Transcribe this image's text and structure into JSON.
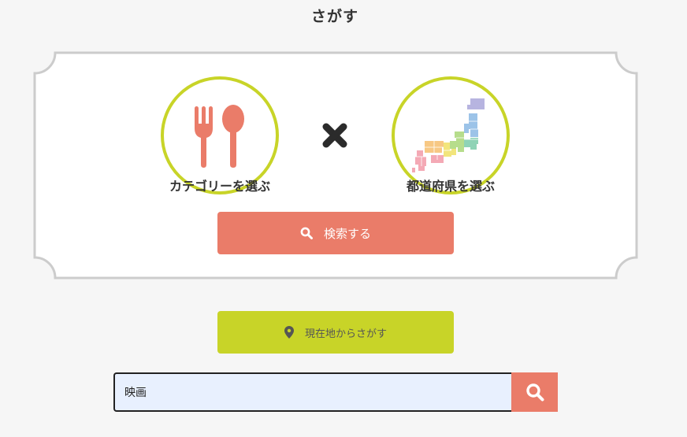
{
  "page": {
    "title": "さがす"
  },
  "picker": {
    "category_label": "カテゴリーを選ぶ",
    "category_icon": "fork-spoon-icon",
    "prefecture_label": "都道府県を選ぶ",
    "prefecture_icon": "japan-map-icon",
    "separator_icon": "times-icon"
  },
  "search_button": {
    "label": "検索する",
    "icon": "search-icon"
  },
  "location_button": {
    "label": "現在地からさがす",
    "icon": "location-pin-icon"
  },
  "keyword_search": {
    "value": "映画",
    "submit_icon": "search-icon"
  },
  "colors": {
    "background": "#f6f6f6",
    "accent_salmon": "#ea7c69",
    "accent_lime": "#c8d428",
    "frame_border": "#cccccc",
    "input_bg": "#e8f0fe"
  }
}
